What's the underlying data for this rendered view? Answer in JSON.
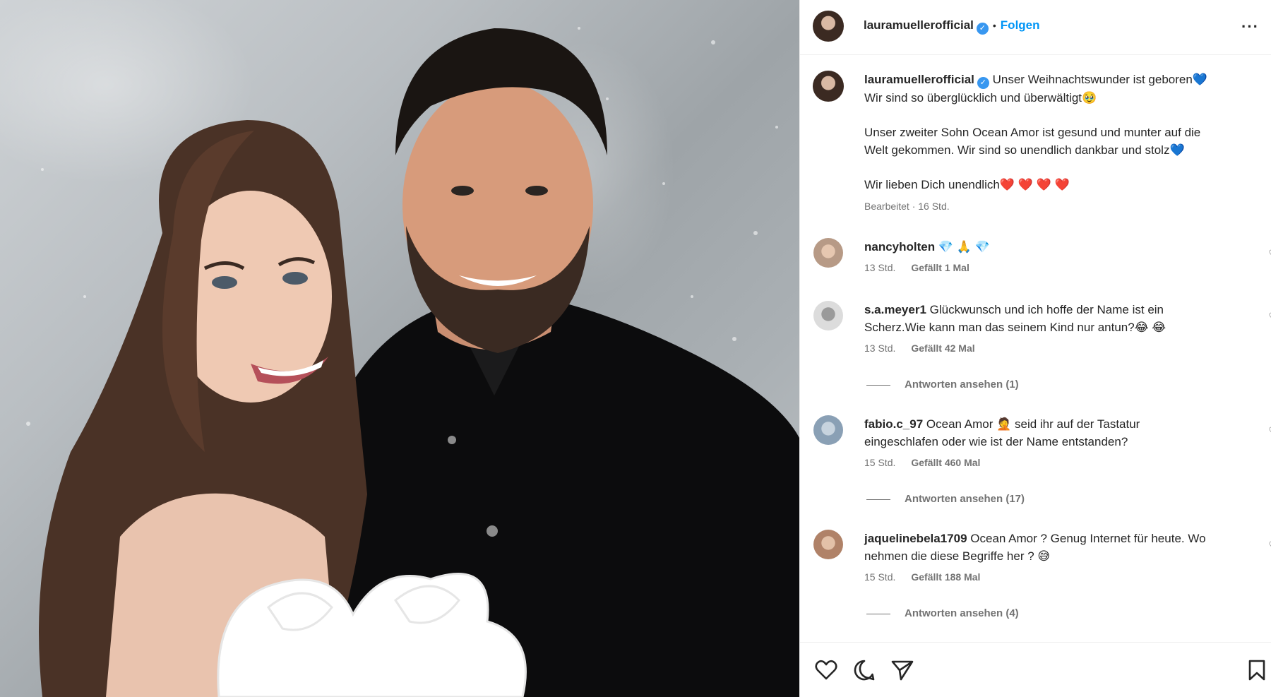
{
  "post": {
    "author": "lauramuellerofficial",
    "follow_label": "Folgen",
    "dot": "•",
    "more_label": "···",
    "caption": {
      "author": "lauramuellerofficial",
      "line1": "Unser Weihnachtswunder ist geboren💙",
      "line2": "Wir sind so überglücklich und überwältigt🥹",
      "line3": "Unser zweiter Sohn Ocean Amor ist gesund und munter auf die",
      "line4": "Welt gekommen. Wir sind so unendlich dankbar und stolz💙",
      "line5": "Wir lieben Dich unendlich❤️ ❤️ ❤️ ❤️",
      "meta": "Bearbeitet · 16 Std."
    }
  },
  "comments": [
    {
      "user": "nancyholten",
      "text_line1": "💎 🙏 💎",
      "text_line2": "",
      "time": "13 Std.",
      "likes": "Gefällt 1 Mal",
      "replies": ""
    },
    {
      "user": "s.a.meyer1",
      "text_line1": "Glückwunsch und ich hoffe der Name ist ein",
      "text_line2": "Scherz.Wie kann man das seinem Kind nur antun?😂 😂",
      "time": "13 Std.",
      "likes": "Gefällt 42 Mal",
      "replies": "Antworten ansehen (1)"
    },
    {
      "user": "fabio.c_97",
      "text_line1": "Ocean Amor 🤦 seid ihr auf der Tastatur",
      "text_line2": "eingeschlafen oder wie ist der Name entstanden?",
      "time": "15 Std.",
      "likes": "Gefällt 460 Mal",
      "replies": "Antworten ansehen (17)"
    },
    {
      "user": "jaquelinebela1709",
      "text_line1": "Ocean Amor ? Genug Internet für heute. Wo",
      "text_line2": "nehmen die diese Begriffe her ? 😅",
      "time": "15 Std.",
      "likes": "Gefällt 188 Mal",
      "replies": "Antworten ansehen (4)"
    }
  ],
  "icons": {
    "verified": "✓",
    "comment_heart": "♡"
  },
  "colors": {
    "link_blue": "#0095f6",
    "verified_blue": "#3897f0",
    "muted": "#737373"
  }
}
